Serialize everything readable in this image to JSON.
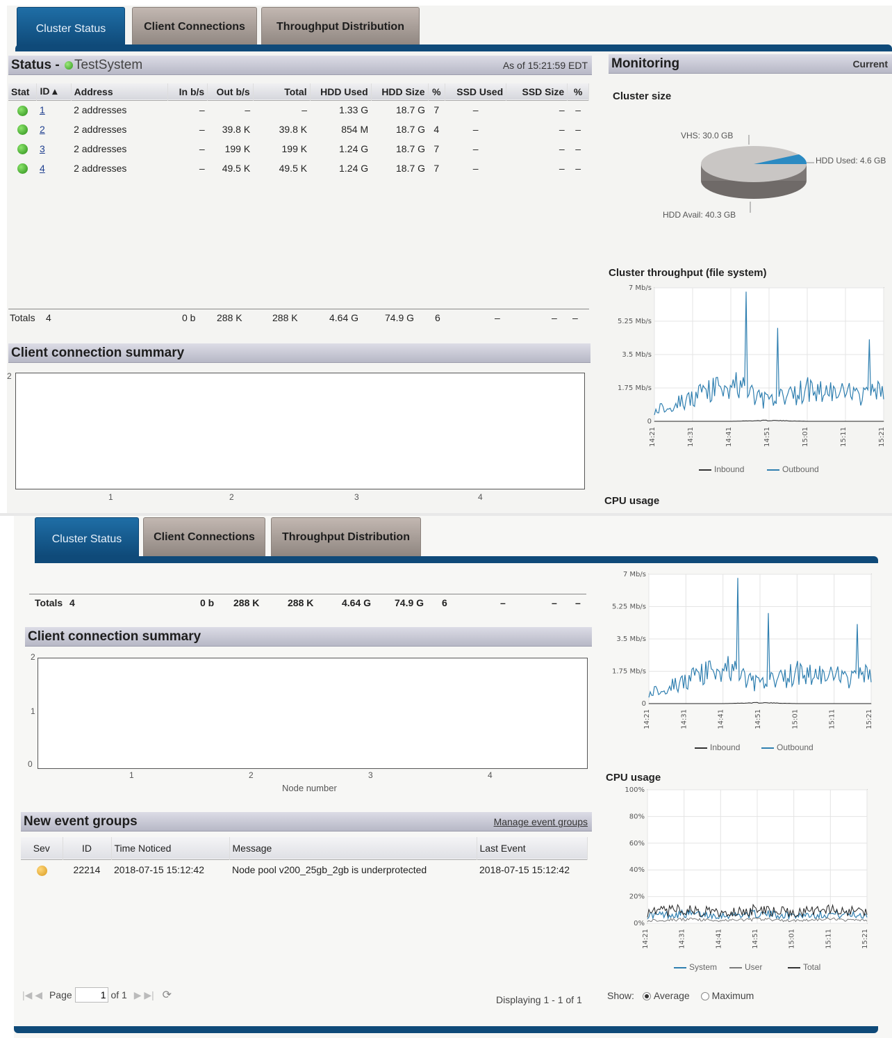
{
  "tabs": [
    "Cluster Status",
    "Client Connections",
    "Throughput Distribution"
  ],
  "status": {
    "title": "Status - ",
    "system_name": "TestSystem",
    "as_of": "As of 15:21:59 EDT"
  },
  "monitoring": {
    "title": "Monitoring",
    "mode": "Current"
  },
  "node_table": {
    "columns": [
      "Stat",
      "ID",
      "Address",
      "In b/s",
      "Out b/s",
      "Total",
      "HDD Used",
      "HDD Size",
      "%",
      "SSD Used",
      "SSD Size",
      "%"
    ],
    "sort_indicator": "▴",
    "rows": [
      {
        "id": "1",
        "address": "2 addresses",
        "in": "–",
        "out": "–",
        "total": "–",
        "hdd_used": "1.33 G",
        "hdd_size": "18.7 G",
        "pct": "7",
        "ssd_used": "–",
        "ssd_size": "–",
        "ssd_pct": "–"
      },
      {
        "id": "2",
        "address": "2 addresses",
        "in": "–",
        "out": "39.8 K",
        "total": "39.8 K",
        "hdd_used": "854 M",
        "hdd_size": "18.7 G",
        "pct": "4",
        "ssd_used": "–",
        "ssd_size": "–",
        "ssd_pct": "–"
      },
      {
        "id": "3",
        "address": "2 addresses",
        "in": "–",
        "out": "199 K",
        "total": "199 K",
        "hdd_used": "1.24 G",
        "hdd_size": "18.7 G",
        "pct": "7",
        "ssd_used": "–",
        "ssd_size": "–",
        "ssd_pct": "–"
      },
      {
        "id": "4",
        "address": "2 addresses",
        "in": "–",
        "out": "49.5 K",
        "total": "49.5 K",
        "hdd_used": "1.24 G",
        "hdd_size": "18.7 G",
        "pct": "7",
        "ssd_used": "–",
        "ssd_size": "–",
        "ssd_pct": "–"
      }
    ],
    "totals": {
      "label": "Totals",
      "count": "4",
      "in": "0 b",
      "out": "288 K",
      "total": "288 K",
      "hdd_used": "4.64 G",
      "hdd_size": "74.9 G",
      "pct": "6",
      "ssd_used": "–",
      "ssd_size": "–",
      "ssd_pct": "–"
    }
  },
  "client_summary": {
    "title": "Client connection summary",
    "x_label": "Node number"
  },
  "cluster_size": {
    "title": "Cluster size",
    "labels": {
      "vhs": "VHS: 30.0 GB",
      "hdd_used": "HDD Used: 4.6 GB",
      "hdd_avail": "HDD Avail: 40.3 GB"
    }
  },
  "throughput": {
    "title": "Cluster throughput (file system)",
    "legend": [
      "Inbound",
      "Outbound"
    ]
  },
  "cpu": {
    "title": "CPU usage",
    "legend": [
      "System",
      "User",
      "Total"
    ]
  },
  "events": {
    "title": "New event groups",
    "manage_link": "Manage event groups",
    "columns": [
      "Sev",
      "ID",
      "Time Noticed",
      "Message",
      "Last Event"
    ],
    "rows": [
      {
        "id": "22214",
        "time": "2018-07-15 15:12:42",
        "message": "Node pool v200_25gb_2gb is underprotected",
        "last": "2018-07-15 15:12:42"
      }
    ]
  },
  "pager": {
    "page_label": "Page",
    "page_value": "1",
    "of": "of 1",
    "displaying": "Displaying 1 - 1 of 1"
  },
  "show": {
    "label": "Show:",
    "options": [
      "Average",
      "Maximum"
    ],
    "selected": "Average"
  },
  "colors": {
    "tab_active": "#0f4a79",
    "ok_status": "#2f9b1c",
    "warning": "#d99a1f",
    "throughput_line": "#2f7fb0"
  },
  "chart_data": [
    {
      "type": "pie",
      "title": "Cluster size",
      "categories": [
        "VHS",
        "HDD Used",
        "HDD Avail"
      ],
      "values": [
        30.0,
        4.6,
        40.3
      ],
      "units": "GB"
    },
    {
      "type": "line",
      "title": "Cluster throughput (file system)",
      "x": [
        "14:21",
        "14:31",
        "14:41",
        "14:51",
        "15:01",
        "15:11",
        "15:21"
      ],
      "yticks": [
        "0",
        "1.75 Mb/s",
        "3.5 Mb/s",
        "5.25 Mb/s",
        "7 Mb/s"
      ],
      "ylim": [
        0,
        7
      ],
      "units": "Mb/s",
      "series": [
        {
          "name": "Inbound",
          "values": [
            0.0,
            0.0,
            0.0,
            0.05,
            0.0,
            0.0,
            0.0
          ]
        },
        {
          "name": "Outbound",
          "values": [
            0.6,
            1.2,
            2.0,
            1.0,
            1.7,
            1.4,
            1.5
          ]
        }
      ]
    },
    {
      "type": "line",
      "title": "CPU usage",
      "x": [
        "14:21",
        "14:31",
        "14:41",
        "14:51",
        "15:01",
        "15:11",
        "15:21"
      ],
      "yticks": [
        "0%",
        "20%",
        "40%",
        "60%",
        "80%",
        "100%"
      ],
      "ylim": [
        0,
        100
      ],
      "series": [
        {
          "name": "System",
          "values": [
            6,
            7,
            6,
            7,
            6,
            7,
            6
          ]
        },
        {
          "name": "User",
          "values": [
            2,
            3,
            2,
            3,
            2,
            3,
            2
          ]
        },
        {
          "name": "Total",
          "values": [
            8,
            10,
            8,
            10,
            8,
            10,
            8
          ]
        }
      ]
    },
    {
      "type": "bar",
      "title": "Client connection summary",
      "xlabel": "Node number",
      "categories": [
        "1",
        "2",
        "3",
        "4"
      ],
      "values": [
        0,
        0,
        0,
        0
      ],
      "ylim": [
        0,
        2
      ]
    }
  ]
}
